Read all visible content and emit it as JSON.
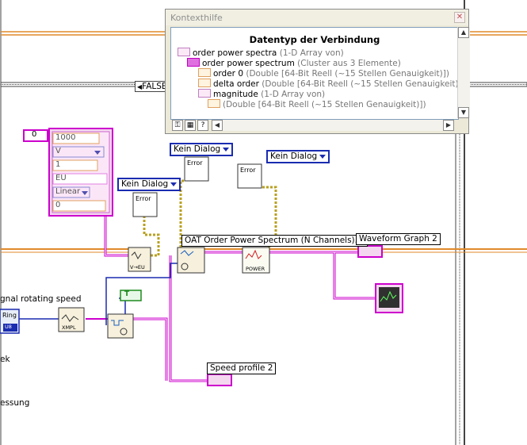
{
  "help": {
    "title": "Kontexthilfe",
    "heading": "Datentyp der Verbindung",
    "rows": [
      {
        "name": "order power spectra",
        "desc": "(1-D Array von)"
      },
      {
        "name": "order power spectrum",
        "desc": "(Cluster aus 3 Elemente)"
      },
      {
        "name": "order 0",
        "desc": "(Double [64-Bit Reell (~15 Stellen Genauigkeit)])"
      },
      {
        "name": "delta order",
        "desc": "(Double [64-Bit Reell (~15 Stellen Genauigkeit)])"
      },
      {
        "name": "magnitude",
        "desc": "(1-D Array von)"
      },
      {
        "name": "",
        "desc": "(Double [64-Bit Reell (~15 Stellen Genauigkeit)])"
      }
    ],
    "icons": [
      "array-icon",
      "cluster-icon",
      "double-icon",
      "double-icon",
      "array-icon",
      "double-icon"
    ]
  },
  "diagram": {
    "case_selector": "FALSE",
    "numeric_index": "0",
    "cluster_values": [
      "1000",
      "V",
      "1",
      "EU",
      "Linear",
      "0"
    ],
    "dialog_options": [
      "Kein Dialog",
      "Kein Dialog",
      "Kein Dialog"
    ],
    "error_icon_text": "Error",
    "vi_label": "OAT Order Power Spectrum (N Channels).vi",
    "waveform_graph_label": "Waveform Graph 2",
    "speed_profile_label": "Speed profile 2",
    "signal_label": "gnal rotating speed",
    "boolean_const": "T",
    "left_texts": [
      "ek",
      "essung"
    ],
    "node_texts": {
      "v_to_eu": "V→EU",
      "xmpl": "XMPL",
      "power": "POWER",
      "ring": "Ring",
      "u8": "U8"
    }
  },
  "colors": {
    "pink_wire": "#cc00cc",
    "orange_wire": "#e08a2a",
    "blue_wire": "#1a2cb0",
    "yellow_wire": "#b8a020"
  }
}
